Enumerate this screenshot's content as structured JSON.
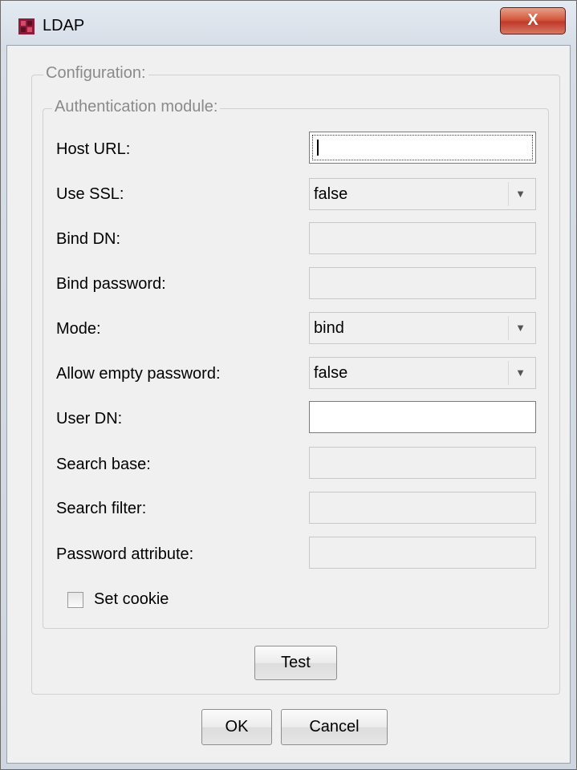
{
  "window": {
    "title": "LDAP",
    "close_glyph": "X",
    "app_icon": "ldap-app-icon",
    "accent": "#c0392b"
  },
  "config_group": {
    "legend": "Configuration:"
  },
  "auth_group": {
    "legend": "Authentication module:"
  },
  "fields": {
    "host_url": {
      "label": "Host URL:",
      "value": ""
    },
    "use_ssl": {
      "label": "Use SSL:",
      "value": "false"
    },
    "bind_dn": {
      "label": "Bind DN:",
      "value": ""
    },
    "bind_password": {
      "label": "Bind password:",
      "value": ""
    },
    "mode": {
      "label": "Mode:",
      "value": "bind"
    },
    "allow_empty_password": {
      "label": "Allow empty password:",
      "value": "false"
    },
    "user_dn": {
      "label": "User DN:",
      "value": ""
    },
    "search_base": {
      "label": "Search base:",
      "value": ""
    },
    "search_filter": {
      "label": "Search filter:",
      "value": ""
    },
    "password_attribute": {
      "label": "Password attribute:",
      "value": ""
    }
  },
  "set_cookie": {
    "label": "Set cookie",
    "checked": false
  },
  "buttons": {
    "test": "Test",
    "ok": "OK",
    "cancel": "Cancel"
  }
}
